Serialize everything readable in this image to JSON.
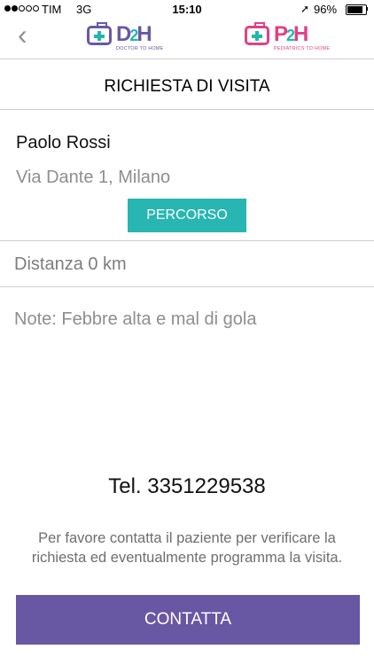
{
  "status_bar": {
    "carrier": "TIM",
    "network": "3G",
    "time": "15:10",
    "battery": "96%",
    "battery_level": 0.96,
    "signal_bars": 2,
    "signal_max": 5
  },
  "nav": {
    "back_icon": "chevron-left-icon",
    "logo_doctor": {
      "mark_left": "D",
      "mark_mid": "2",
      "mark_right": "H",
      "subtitle": "DOCTOR TO HOME"
    },
    "logo_pediatrics": {
      "mark_left": "P",
      "mark_mid": "2",
      "mark_right": "H",
      "subtitle": "PEDIATRICS TO HOME"
    }
  },
  "page": {
    "title": "RICHIESTA DI VISITA"
  },
  "patient": {
    "name": "Paolo Rossi",
    "address": "Via Dante 1, Milano",
    "route_button": "PERCORSO",
    "distance": "Distanza 0 km",
    "notes": "Note: Febbre alta e mal di gola"
  },
  "contact": {
    "phone": "Tel. 3351229538",
    "message": "Per favore contatta il paziente per verificare la richiesta ed eventualmente programma la visita.",
    "button": "CONTATTA"
  },
  "colors": {
    "accent_purple": "#6858a3",
    "accent_teal": "#28b6b2",
    "accent_pink": "#e23f86"
  }
}
